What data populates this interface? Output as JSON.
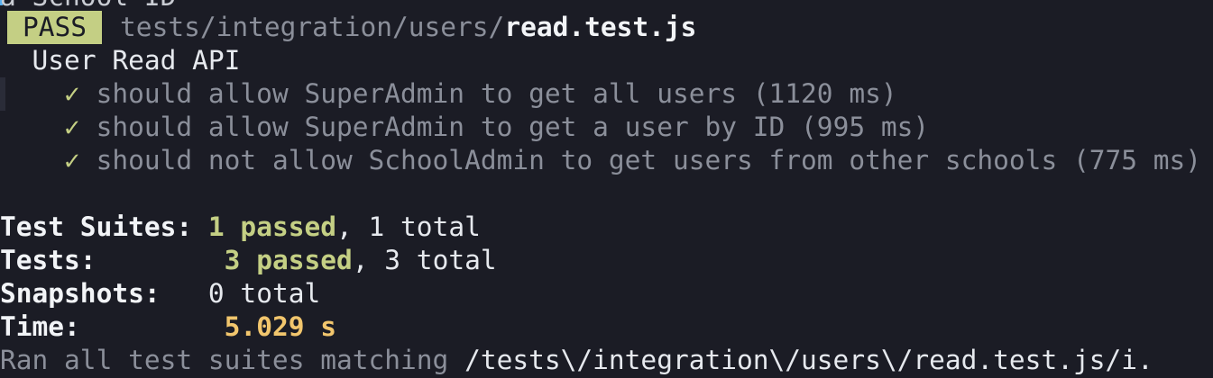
{
  "terminal": {
    "prev_line_fragment": "a School ID",
    "result": {
      "status": "PASS",
      "path_dir": "tests/integration/users/",
      "path_file": "read.test.js"
    },
    "describe": "User Read API",
    "tests": [
      {
        "icon": "✓",
        "name": "should allow SuperAdmin to get all users",
        "duration": "(1120 ms)"
      },
      {
        "icon": "✓",
        "name": "should allow SuperAdmin to get a user by ID",
        "duration": "(995 ms)"
      },
      {
        "icon": "✓",
        "name": "should not allow SchoolAdmin to get users from other schools",
        "duration": "(775 ms)"
      }
    ],
    "summary": {
      "suites_label": "Test Suites:",
      "suites_passed": "1 passed",
      "suites_total": ", 1 total",
      "tests_label": "Tests:",
      "tests_passed": "3 passed",
      "tests_total": ", 3 total",
      "snapshots_label": "Snapshots:",
      "snapshots_value": "0 total",
      "time_label": "Time:",
      "time_value": "5.029 s"
    },
    "footer": {
      "prefix": "Ran all test suites matching ",
      "pattern": "/tests\\/integration\\/users\\/read.test.js/i."
    },
    "colors": {
      "background": "#1b1c25",
      "pass_badge": "#c4cf84",
      "green": "#c4cf84",
      "yellow": "#f2c66d",
      "dim": "#8b8f9a"
    }
  }
}
